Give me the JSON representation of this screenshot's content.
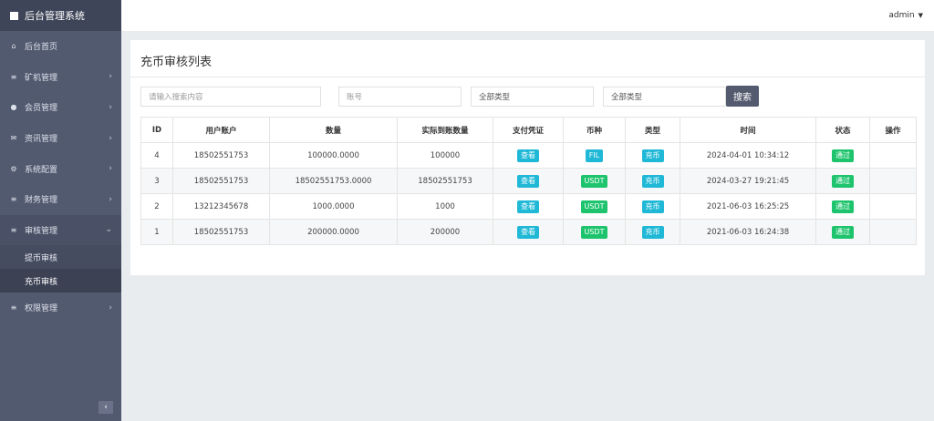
{
  "sidebar": {
    "brand": "后台管理系统",
    "items": [
      {
        "label": "后台首页",
        "icon": "home-icon",
        "glyph": "⌂",
        "chev": ""
      },
      {
        "label": "矿机管理",
        "icon": "list-icon",
        "glyph": "≡",
        "chev": "›"
      },
      {
        "label": "会员管理",
        "icon": "user-icon",
        "glyph": "●",
        "chev": "›"
      },
      {
        "label": "资讯管理",
        "icon": "mail-icon",
        "glyph": "✉",
        "chev": "›"
      },
      {
        "label": "系统配置",
        "icon": "gear-icon",
        "glyph": "⚙",
        "chev": "›"
      },
      {
        "label": "财务管理",
        "icon": "list-icon",
        "glyph": "≡",
        "chev": "›"
      },
      {
        "label": "审核管理",
        "icon": "list-icon",
        "glyph": "≡",
        "chev": "⌄"
      },
      {
        "label": "权限管理",
        "icon": "list-icon",
        "glyph": "≡",
        "chev": "›"
      }
    ],
    "subitems": [
      "提币审核",
      "充币审核"
    ],
    "collapse_glyph": "‹"
  },
  "header": {
    "user": "admin",
    "caret": "▼"
  },
  "main": {
    "title": "充币审核列表",
    "filters": {
      "search_placeholder": "请输入搜索内容",
      "account_placeholder": "账号",
      "type1": "全部类型",
      "type2": "全部类型",
      "search_button": "搜索"
    },
    "columns": [
      "ID",
      "用户账户",
      "数量",
      "实际到账数量",
      "支付凭证",
      "币种",
      "类型",
      "时间",
      "状态",
      "操作"
    ],
    "rows": [
      {
        "id": "4",
        "account": "18502551753",
        "amount": "100000.0000",
        "actual": "100000",
        "voucher": "查看",
        "coin": "FIL",
        "type": "充币",
        "time": "2024-04-01 10:34:12",
        "status": "通过",
        "op": ""
      },
      {
        "id": "3",
        "account": "18502551753",
        "amount": "18502551753.0000",
        "actual": "18502551753",
        "voucher": "查看",
        "coin": "USDT",
        "type": "充币",
        "time": "2024-03-27 19:21:45",
        "status": "通过",
        "op": ""
      },
      {
        "id": "2",
        "account": "13212345678",
        "amount": "1000.0000",
        "actual": "1000",
        "voucher": "查看",
        "coin": "USDT",
        "type": "充币",
        "time": "2021-06-03 16:25:25",
        "status": "通过",
        "op": ""
      },
      {
        "id": "1",
        "account": "18502551753",
        "amount": "200000.0000",
        "actual": "200000",
        "voucher": "查看",
        "coin": "USDT",
        "type": "充币",
        "time": "2021-06-03 16:24:38",
        "status": "通过",
        "op": ""
      }
    ]
  },
  "colors": {
    "sidebar": "#525a70",
    "brand": "#3e4558",
    "tag_blue": "#1fb8d6",
    "tag_green": "#1ec46d",
    "button": "#545b6e"
  }
}
